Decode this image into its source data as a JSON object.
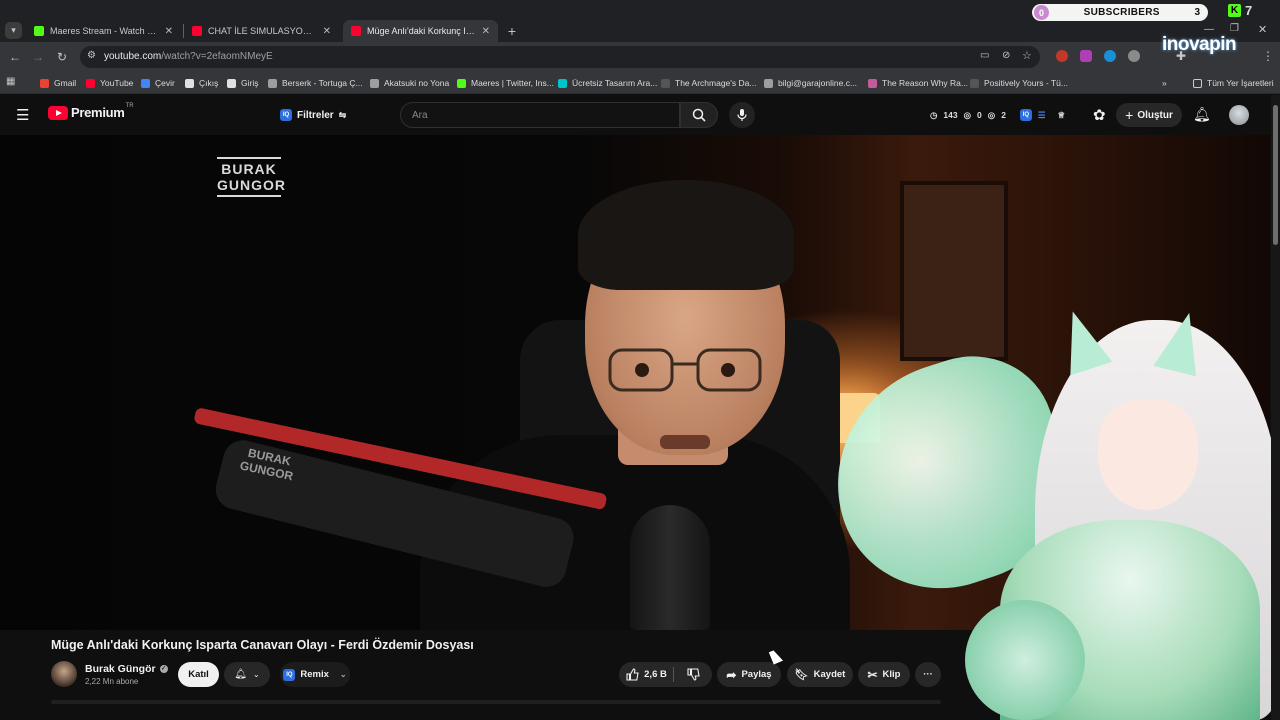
{
  "browser": {
    "tabs": [
      {
        "title": "Maeres Stream - Watch Live on",
        "favicon_color": "#53fc18"
      },
      {
        "title": "CHAT İLE SIMULASYON KEYFİ |",
        "favicon_color": "#ff0033"
      },
      {
        "title": "Müge Anlı'daki Korkunç Isparta",
        "favicon_color": "#ff0033"
      }
    ],
    "new_tab": "+",
    "close": "✕",
    "url_host": "youtube.com",
    "url_path": "/watch?v=2efaomNMeyE",
    "bookmarks": [
      {
        "label": "Gmail",
        "color": "#ea4335"
      },
      {
        "label": "YouTube",
        "color": "#ff0033"
      },
      {
        "label": "Çevir",
        "color": "#4285f4"
      },
      {
        "label": "Çıkış",
        "color": "#e0e0e0"
      },
      {
        "label": "Giriş",
        "color": "#e0e0e0"
      },
      {
        "label": "Berserk - Tortuga Ç...",
        "color": "#9e9e9e"
      },
      {
        "label": "Akatsuki no Yona",
        "color": "#9e9e9e"
      },
      {
        "label": "Maeres | Twitter, Ins...",
        "color": "#53fc18"
      },
      {
        "label": "Ücretsiz Tasarım Ara...",
        "color": "#00c4cc"
      },
      {
        "label": "The Archmage's Da...",
        "color": "#555555"
      },
      {
        "label": "bilgi@garajonline.c...",
        "color": "#9e9e9e"
      },
      {
        "label": "The Reason Why Ra...",
        "color": "#c15b9a"
      },
      {
        "label": "Positively Yours - Tü...",
        "color": "#555555"
      }
    ],
    "all_bookmarks": "Tüm Yer İşaretleri",
    "more": "»"
  },
  "overlay": {
    "subs_label": "SUBSCRIBERS",
    "subs_left": "0",
    "subs_count": "3",
    "kick_count": "7",
    "kick_letter": "K",
    "brand": "inovapin"
  },
  "youtube": {
    "logo_text": "Premium",
    "logo_region": "TR",
    "filter_label": "Filtreler",
    "iq_text": "IQ",
    "search_placeholder": "Ara",
    "stats": [
      "143",
      "0",
      "2"
    ],
    "create_label": "Oluştur",
    "video": {
      "watermark": "BURAK GUNGOR",
      "mic_logo": "BURAK GUNGOR",
      "title": "Müge Anlı'daki Korkunç Isparta Canavarı Olayı - Ferdi Özdemir Dosyası"
    },
    "channel": {
      "name": "Burak Güngör",
      "verified": "✓",
      "subscribers": "2,22 Mn abone"
    },
    "join_label": "Katıl",
    "remix_label": "Remix",
    "likes": "2,6 B",
    "share_label": "Paylaş",
    "save_label": "Kaydet",
    "clip_label": "Klip",
    "more_label": "···"
  }
}
